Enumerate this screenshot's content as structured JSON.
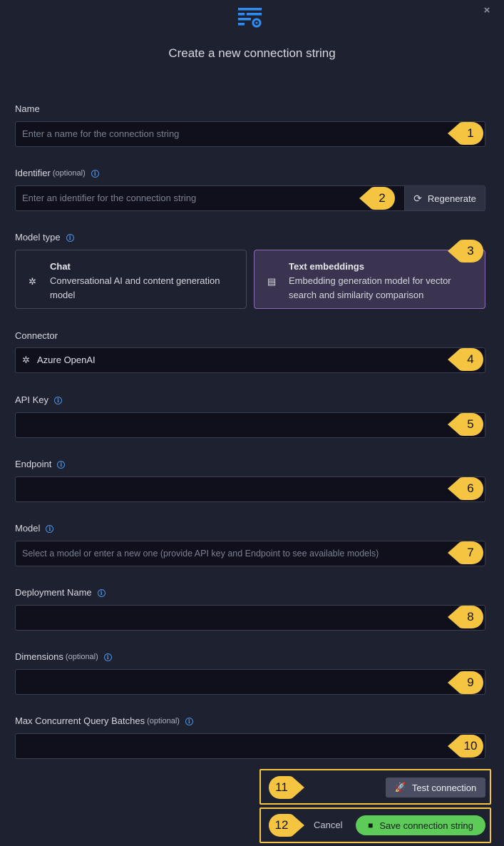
{
  "header": {
    "title": "Create a new connection string",
    "close_symbol": "×",
    "icon": "connection-string-settings-icon",
    "accent": "#2f8cf0"
  },
  "fields": {
    "name": {
      "label": "Name",
      "placeholder": "Enter a name for the connection string"
    },
    "identifier": {
      "label": "Identifier",
      "optional": "(optional)",
      "placeholder": "Enter an identifier for the connection string",
      "regenerate": "Regenerate"
    },
    "model_type": {
      "label": "Model type",
      "chat": {
        "title": "Chat",
        "desc": "Conversational AI and content generation model"
      },
      "text_embeddings": {
        "title": "Text embeddings",
        "desc": "Embedding generation model for vector search and similarity comparison",
        "selected": true
      }
    },
    "connector": {
      "label": "Connector",
      "value": "Azure OpenAI"
    },
    "api_key": {
      "label": "API Key",
      "value": ""
    },
    "endpoint": {
      "label": "Endpoint",
      "value": ""
    },
    "model": {
      "label": "Model",
      "placeholder": "Select a model or enter a new one (provide API key and Endpoint to see available models)"
    },
    "deployment_name": {
      "label": "Deployment Name",
      "value": ""
    },
    "dimensions": {
      "label": "Dimensions",
      "optional": "(optional)",
      "value": ""
    },
    "max_batches": {
      "label": "Max Concurrent Query Batches",
      "optional": "(optional)",
      "value": ""
    }
  },
  "footer": {
    "test_connection": "Test connection",
    "cancel": "Cancel",
    "save": "Save connection string",
    "save_color": "#5ccb57"
  },
  "callouts": [
    "1",
    "2",
    "3",
    "4",
    "5",
    "6",
    "7",
    "8",
    "9",
    "10",
    "11",
    "12"
  ],
  "colors": {
    "callout": "#f5c542",
    "background": "#1e2130",
    "input_bg": "#0f101c",
    "selected_card": "#3b3450"
  }
}
